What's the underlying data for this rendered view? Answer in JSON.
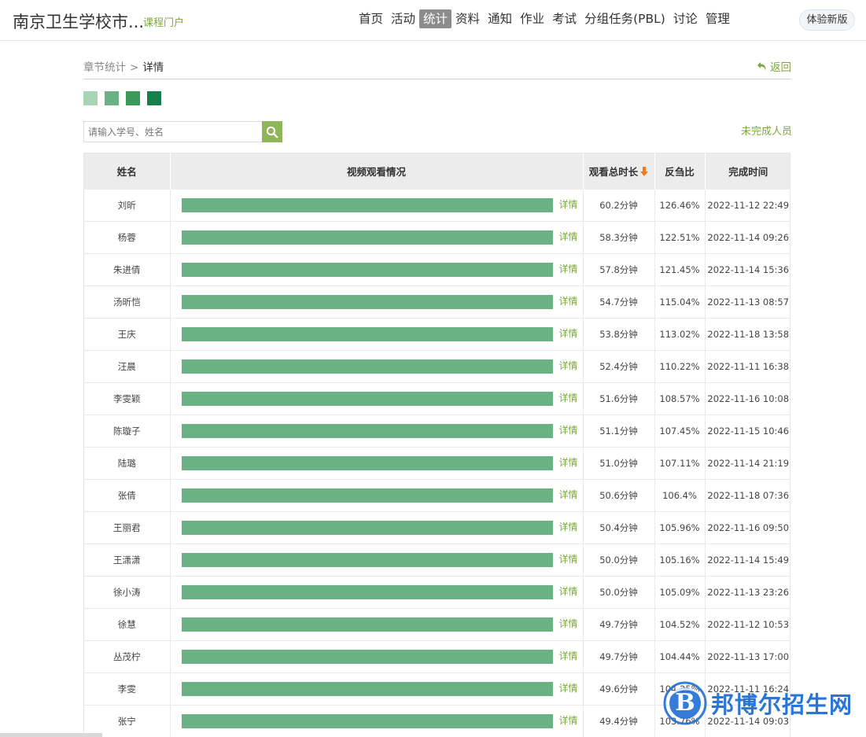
{
  "header": {
    "site_title": "南京卫生学校市...",
    "portal_link": "课程门户",
    "nav": [
      {
        "label": "首页",
        "active": false
      },
      {
        "label": "活动",
        "active": false
      },
      {
        "label": "统计",
        "active": true
      },
      {
        "label": "资料",
        "active": false
      },
      {
        "label": "通知",
        "active": false
      },
      {
        "label": "作业",
        "active": false
      },
      {
        "label": "考试",
        "active": false
      },
      {
        "label": "分组任务(PBL)",
        "active": false
      },
      {
        "label": "讨论",
        "active": false
      },
      {
        "label": "管理",
        "active": false
      }
    ],
    "new_version_button": "体验新版"
  },
  "breadcrumb": {
    "parent": "章节统计",
    "separator": ">",
    "current": "详情"
  },
  "back_link": "返回",
  "legend_colors": [
    "#a8d5b5",
    "#6ab283",
    "#3a9a58",
    "#18804d"
  ],
  "search": {
    "placeholder": "请输入学号、姓名",
    "icon": "search-icon"
  },
  "incomplete_link": "未完成人员",
  "table": {
    "headers": {
      "name": "姓名",
      "video": "视频观看情况",
      "duration": "观看总时长",
      "ratio": "反刍比",
      "finish_time": "完成时间"
    },
    "detail_label": "详情",
    "bar_color": "#6ab283",
    "rows": [
      {
        "name": "刘昕",
        "progress": 1.0,
        "duration": "60.2分钟",
        "ratio": "126.46%",
        "finish_time": "2022-11-12 22:49"
      },
      {
        "name": "杨蓉",
        "progress": 1.0,
        "duration": "58.3分钟",
        "ratio": "122.51%",
        "finish_time": "2022-11-14 09:26"
      },
      {
        "name": "朱进倩",
        "progress": 1.0,
        "duration": "57.8分钟",
        "ratio": "121.45%",
        "finish_time": "2022-11-14 15:36"
      },
      {
        "name": "汤昕恺",
        "progress": 1.0,
        "duration": "54.7分钟",
        "ratio": "115.04%",
        "finish_time": "2022-11-13 08:57"
      },
      {
        "name": "王庆",
        "progress": 1.0,
        "duration": "53.8分钟",
        "ratio": "113.02%",
        "finish_time": "2022-11-18 13:58"
      },
      {
        "name": "汪晨",
        "progress": 1.0,
        "duration": "52.4分钟",
        "ratio": "110.22%",
        "finish_time": "2022-11-11 16:38"
      },
      {
        "name": "李雯颖",
        "progress": 1.0,
        "duration": "51.6分钟",
        "ratio": "108.57%",
        "finish_time": "2022-11-16 10:08"
      },
      {
        "name": "陈璇子",
        "progress": 1.0,
        "duration": "51.1分钟",
        "ratio": "107.45%",
        "finish_time": "2022-11-15 10:46"
      },
      {
        "name": "陆璐",
        "progress": 1.0,
        "duration": "51.0分钟",
        "ratio": "107.11%",
        "finish_time": "2022-11-14 21:19"
      },
      {
        "name": "张倩",
        "progress": 1.0,
        "duration": "50.6分钟",
        "ratio": "106.4%",
        "finish_time": "2022-11-18 07:36"
      },
      {
        "name": "王丽君",
        "progress": 1.0,
        "duration": "50.4分钟",
        "ratio": "105.96%",
        "finish_time": "2022-11-16 09:50"
      },
      {
        "name": "王潇潇",
        "progress": 1.0,
        "duration": "50.0分钟",
        "ratio": "105.16%",
        "finish_time": "2022-11-14 15:49"
      },
      {
        "name": "徐小涛",
        "progress": 1.0,
        "duration": "50.0分钟",
        "ratio": "105.09%",
        "finish_time": "2022-11-13 23:26"
      },
      {
        "name": "徐慧",
        "progress": 1.0,
        "duration": "49.7分钟",
        "ratio": "104.52%",
        "finish_time": "2022-11-12 10:53"
      },
      {
        "name": "丛茂柠",
        "progress": 1.0,
        "duration": "49.7分钟",
        "ratio": "104.44%",
        "finish_time": "2022-11-13 17:00"
      },
      {
        "name": "李雯",
        "progress": 1.0,
        "duration": "49.6分钟",
        "ratio": "104.35%",
        "finish_time": "2022-11-11 16:24"
      },
      {
        "name": "张宁",
        "progress": 1.0,
        "duration": "49.4分钟",
        "ratio": "103.76%",
        "finish_time": "2022-11-14 09:03"
      }
    ]
  },
  "watermark": {
    "text": "邦博尔招生网",
    "logo_letter": "B"
  }
}
